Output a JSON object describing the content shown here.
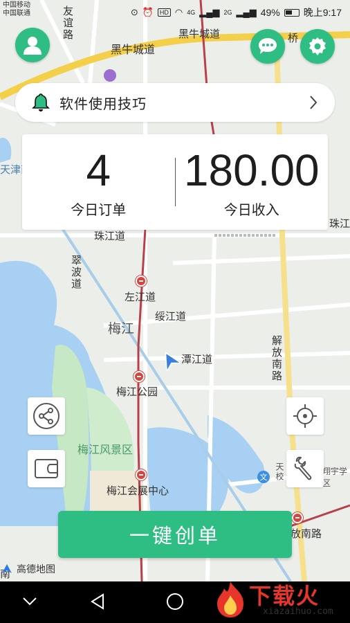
{
  "status_bar": {
    "carrier_line1": "中国移动",
    "carrier_line2": "中国联通",
    "network_1": "4G",
    "network_2": "2G",
    "hd": "HD",
    "battery": "49%",
    "time": "晚上9:17"
  },
  "tips": {
    "text": "软件使用技巧"
  },
  "stats": {
    "orders_value": "4",
    "orders_label": "今日订单",
    "income_value": "180.00",
    "income_label": "今日收入"
  },
  "actions": {
    "create_order": "一键创单"
  },
  "map": {
    "labels": {
      "heiniucheng": "黑牛城道",
      "heiniucheng2": "黑牛城道",
      "youyi": "友谊路",
      "tianjin": "天津南",
      "bridge": "桥",
      "zhujiang": "珠江道",
      "zhujiang2": "珠江",
      "cuibo": "翠波道",
      "zuojiang": "左江道",
      "suijiang": "绥江道",
      "meijiang": "梅江",
      "tanjiang": "潭江道",
      "meijiang_park": "梅江公园",
      "jiefang": "解放南路",
      "scenic": "梅江风景区",
      "exhibition": "梅江会展中心",
      "tianxiao": "天校",
      "xiangyu": "翔宇学区",
      "fangnan": "放南路",
      "south": "南"
    },
    "logo": "高德地图"
  },
  "watermark": {
    "text": "下载火",
    "url": "xiazaihuo.com"
  },
  "colors": {
    "accent": "#2ebd83",
    "metro": "#d6453e",
    "road_major": "#f6d55c"
  }
}
